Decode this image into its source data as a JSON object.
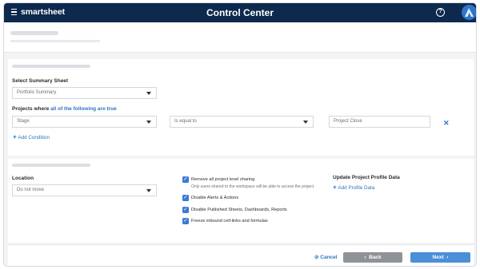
{
  "topbar": {
    "brand": "smartsheet",
    "title": "Control Center",
    "help_glyph": "?",
    "icons": [
      "menu-icon",
      "help-icon",
      "avatar"
    ]
  },
  "summary": {
    "select_label": "Select Summary Sheet",
    "selected_sheet": "Portfolio Summary",
    "criteria_prefix": "Projects where ",
    "criteria_highlight": "all of the following are true",
    "condition_field": "Stage",
    "condition_operator": "Is equal to",
    "condition_value": "Project Close",
    "add_condition": "Add Condition"
  },
  "options": {
    "location_label": "Location",
    "location_value": "Do not move",
    "checkboxes": [
      {
        "label": "Remove all project level sharing",
        "checked": true
      },
      {
        "label": "Disable Alerts & Actions",
        "checked": true
      },
      {
        "label": "Disable Published Sheets, Dashboards, Reports",
        "checked": true
      },
      {
        "label": "Freeze inbound cell-links and formulas",
        "checked": true
      }
    ],
    "sharing_note": "Only users shared to the workspace will be able to access the project",
    "profile_heading": "Update Project Profile Data",
    "add_profile": "Add Profile Data"
  },
  "footer": {
    "cancel": "Cancel",
    "back": "Back",
    "next": "Next"
  },
  "colors": {
    "topbar": "#0d2a4e",
    "accent": "#2b74c2",
    "next_button": "#4a8fd8",
    "back_button": "#8f9296"
  }
}
